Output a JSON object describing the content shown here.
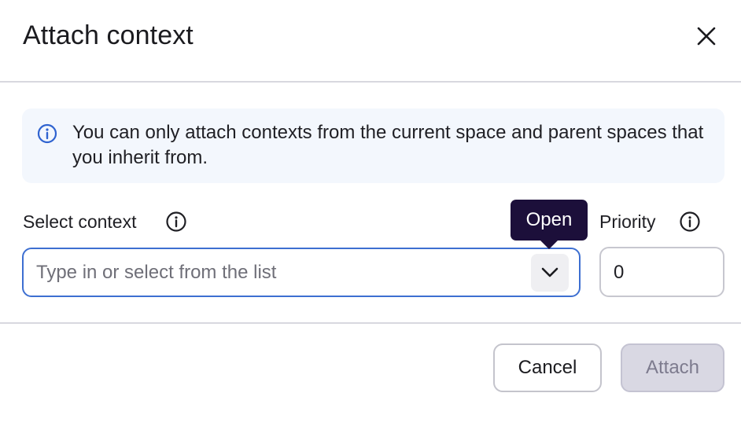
{
  "dialog": {
    "title": "Attach context",
    "close_icon": "close-icon"
  },
  "callout": {
    "icon": "info-icon",
    "text": "You can only attach contexts from the current space and parent spaces that you inherit from."
  },
  "select_context": {
    "label": "Select context",
    "label_icon": "info-icon",
    "value": "",
    "placeholder": "Type in or select from the list",
    "toggle_icon": "chevron-down-icon",
    "tooltip": "Open"
  },
  "priority": {
    "label": "Priority",
    "label_icon": "info-icon",
    "value": "0"
  },
  "footer": {
    "cancel_label": "Cancel",
    "attach_label": "Attach",
    "attach_disabled": true
  },
  "colors": {
    "focus_border": "#3d6fd1",
    "callout_background": "#f3f7fd",
    "tooltip_background": "#1c0f3a",
    "disabled_button": "#d9d8e3"
  }
}
